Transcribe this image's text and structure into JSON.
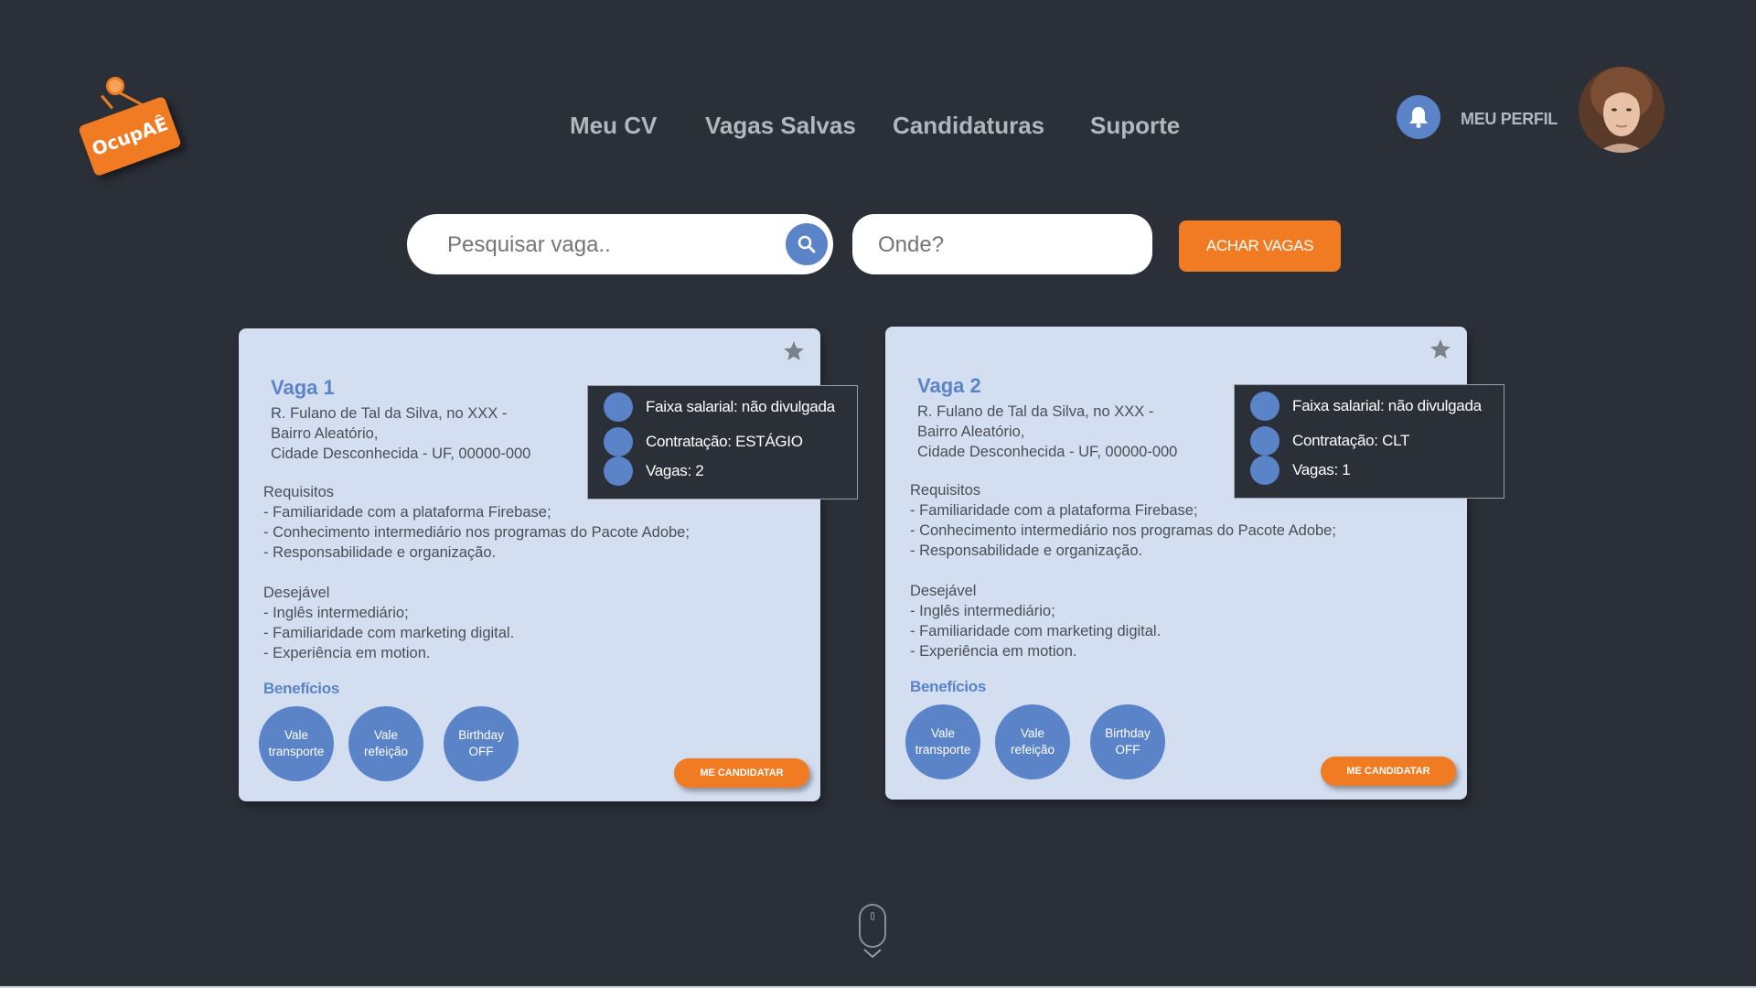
{
  "logo": {
    "text": "OcupAÊ"
  },
  "nav": {
    "items": [
      "Meu CV",
      "Vagas Salvas",
      "Candidaturas",
      "Suporte"
    ]
  },
  "header": {
    "profile_label": "MEU PERFIL",
    "bell_icon": "bell-icon"
  },
  "search": {
    "job_placeholder": "Pesquisar vaga..",
    "where_placeholder": "Onde?",
    "button_label": "ACHAR VAGAS"
  },
  "colors": {
    "background": "#2b2f38",
    "accent": "#f07b22",
    "primary": "#5b84c8",
    "card": "#d3def0"
  },
  "jobs": [
    {
      "title": "Vaga 1",
      "address": [
        "R. Fulano de Tal da Silva, no XXX -",
        "Bairro Aleatório,",
        "Cidade Desconhecida - UF, 00000-000"
      ],
      "requirements_title": "Requisitos",
      "requirements": [
        "-  Familiaridade com a plataforma Firebase;",
        "- Conhecimento intermediário nos programas do Pacote Adobe;",
        "- Responsabilidade e organização."
      ],
      "desirable_title": "Desejável",
      "desirable": [
        "- Inglês intermediário;",
        "- Familiaridade com marketing digital.",
        "- Experiência em motion."
      ],
      "benefits_title": "Benefícios",
      "benefits": [
        [
          "Vale",
          "transporte"
        ],
        [
          "Vale",
          "refeição"
        ],
        [
          "Birthday",
          "OFF"
        ]
      ],
      "info": {
        "salary": "Faixa salarial: não divulgada",
        "contract": "Contratação: ESTÁGIO",
        "openings": "Vagas: 2"
      },
      "apply_label": "ME CANDIDATAR"
    },
    {
      "title": "Vaga 2",
      "address": [
        "R. Fulano de Tal da Silva, no XXX -",
        "Bairro Aleatório,",
        "Cidade Desconhecida - UF, 00000-000"
      ],
      "requirements_title": "Requisitos",
      "requirements": [
        "-  Familiaridade com a plataforma Firebase;",
        "- Conhecimento intermediário nos programas do Pacote Adobe;",
        "- Responsabilidade e organização."
      ],
      "desirable_title": "Desejável",
      "desirable": [
        "- Inglês intermediário;",
        "- Familiaridade com marketing digital.",
        "- Experiência em motion."
      ],
      "benefits_title": "Benefícios",
      "benefits": [
        [
          "Vale",
          "transporte"
        ],
        [
          "Vale",
          "refeição"
        ],
        [
          "Birthday",
          "OFF"
        ]
      ],
      "info": {
        "salary": "Faixa salarial: não divulgada",
        "contract": "Contratação: CLT",
        "openings": "Vagas: 1"
      },
      "apply_label": "ME CANDIDATAR"
    }
  ],
  "scroll_hint": {
    "icon": "mouse-scroll-icon",
    "wheel_label": "0"
  }
}
